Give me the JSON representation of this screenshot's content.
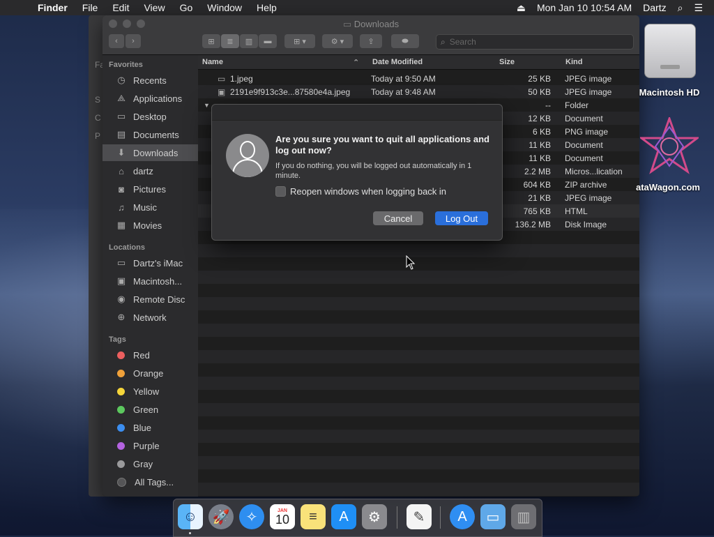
{
  "menubar": {
    "apple_icon": "apple-icon",
    "app": "Finder",
    "items": [
      "File",
      "Edit",
      "View",
      "Go",
      "Window",
      "Help"
    ],
    "clock": "Mon Jan 10  10:54 AM",
    "user": "Dartz"
  },
  "back_window": {
    "labels": [
      "Fa",
      "S",
      "C",
      "P"
    ]
  },
  "window": {
    "title": "Downloads",
    "search_placeholder": "Search"
  },
  "sidebar": {
    "favorites_header": "Favorites",
    "favorites": [
      "Recents",
      "Applications",
      "Desktop",
      "Documents",
      "Downloads",
      "dartz",
      "Pictures",
      "Music",
      "Movies"
    ],
    "locations_header": "Locations",
    "locations": [
      "Dartz's iMac",
      "Macintosh...",
      "Remote Disc",
      "Network"
    ],
    "tags_header": "Tags",
    "tags": [
      {
        "label": "Red",
        "color": "#ec5f5f"
      },
      {
        "label": "Orange",
        "color": "#f0a13a"
      },
      {
        "label": "Yellow",
        "color": "#f5d53a"
      },
      {
        "label": "Green",
        "color": "#5cc85e"
      },
      {
        "label": "Blue",
        "color": "#3c8ef0"
      },
      {
        "label": "Purple",
        "color": "#b463e0"
      },
      {
        "label": "Gray",
        "color": "#9a9a9c"
      },
      {
        "label": "All Tags...",
        "color": "#555557"
      }
    ]
  },
  "list": {
    "columns": {
      "name": "Name",
      "date": "Date Modified",
      "size": "Size",
      "kind": "Kind"
    },
    "rows": [
      {
        "name": "1.jpeg",
        "date": "Today at 9:50 AM",
        "size": "25 KB",
        "kind": "JPEG image"
      },
      {
        "name": "2191e9f913c3e...87580e4a.jpeg",
        "date": "Today at 9:48 AM",
        "size": "50 KB",
        "kind": "JPEG image"
      },
      {
        "name": "",
        "date": "",
        "size": "--",
        "kind": "Folder"
      },
      {
        "name": "",
        "date": "",
        "size": "12 KB",
        "kind": "Document"
      },
      {
        "name": "",
        "date": "",
        "size": "6 KB",
        "kind": "PNG image"
      },
      {
        "name": "",
        "date": "",
        "size": "11 KB",
        "kind": "Document"
      },
      {
        "name": "",
        "date": "",
        "size": "11 KB",
        "kind": "Document"
      },
      {
        "name": "",
        "date": "",
        "size": "2.2 MB",
        "kind": "Micros...lication"
      },
      {
        "name": "",
        "date": "",
        "size": "604 KB",
        "kind": "ZIP archive"
      },
      {
        "name": "",
        "date": "",
        "size": "21 KB",
        "kind": "JPEG image"
      },
      {
        "name": "",
        "date": "",
        "size": "765 KB",
        "kind": "HTML"
      },
      {
        "name": "",
        "date": "",
        "size": "136.2 MB",
        "kind": "Disk Image"
      }
    ]
  },
  "dialog": {
    "title": "Are you sure you want to quit all applications and log out now?",
    "message": "If you do nothing, you will be logged out automatically in 1 minute.",
    "checkbox_label": "Reopen windows when logging back in",
    "checkbox_checked": false,
    "cancel_label": "Cancel",
    "primary_label": "Log Out",
    "primary_color": "#2a6fdb"
  },
  "desktop": {
    "icons": [
      "Macintosh HD",
      "ataWagon.com"
    ]
  },
  "dock": {
    "items": [
      "finder-icon",
      "launchpad-icon",
      "safari-icon",
      "calendar-icon",
      "notes-icon",
      "app-store-icon",
      "system-preferences-icon",
      "textedit-icon",
      "applications-folder-icon",
      "downloads-folder-icon",
      "trash-icon"
    ],
    "calendar_month": "JAN",
    "calendar_day": "10"
  }
}
